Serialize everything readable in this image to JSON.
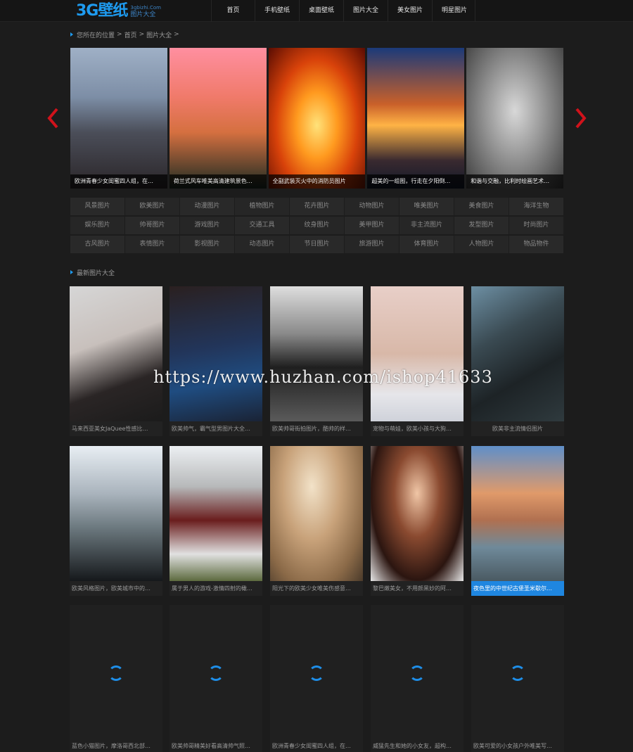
{
  "header": {
    "logo_mark": "3G壁纸",
    "logo_url": "3gbizhi.Com",
    "logo_tag": "图片大全",
    "nav": [
      "首页",
      "手机壁纸",
      "桌面壁纸",
      "图片大全",
      "美女图片",
      "明星图片"
    ]
  },
  "breadcrumb": {
    "label": "您所在的位置",
    "items": [
      "首页",
      "图片大全"
    ],
    "sep": ">"
  },
  "slider": {
    "slides": [
      {
        "caption": "欧洲青春少女闺蜜四人组，在…",
        "art": "g1"
      },
      {
        "caption": "荷兰式风车唯美高清建筑景色…",
        "art": "g2"
      },
      {
        "caption": "全副武装灭火中的消防员图片",
        "art": "g3"
      },
      {
        "caption": "超美的一组图，行走在夕阳倒…",
        "art": "g4"
      },
      {
        "caption": "和谐与交融，比利时绘画艺术…",
        "art": "g5"
      }
    ],
    "prev_icon": "chevron-left-icon",
    "next_icon": "chevron-right-icon",
    "arrow_color": "#d0121b"
  },
  "categories": [
    "风景图片",
    "欧美图片",
    "动漫图片",
    "植物图片",
    "花卉图片",
    "动物图片",
    "唯美图片",
    "美食图片",
    "海洋生物",
    "娱乐图片",
    "帅哥图片",
    "游戏图片",
    "交通工具",
    "纹身图片",
    "美甲图片",
    "非主流图片",
    "发型图片",
    "时尚图片",
    "古风图片",
    "表情图片",
    "影视图片",
    "动态图片",
    "节日图片",
    "旅游图片",
    "体育图片",
    "人物图片",
    "物品物件"
  ],
  "latest": {
    "title": "最新图片大全",
    "rows": [
      [
        {
          "caption": "马来西亚美女JaQuee性感比…",
          "art": "p1"
        },
        {
          "caption": "欧美帅气，霸气型男图片大全…",
          "art": "p2"
        },
        {
          "caption": "欧美帅哥街拍图片，酷帅的样…",
          "art": "p3"
        },
        {
          "caption": "宠物与萌娃，欧美小孩与大狗…",
          "art": "p4"
        },
        {
          "caption": "欧美非主流情侣图片",
          "art": "p5",
          "center": true
        }
      ],
      [
        {
          "caption": "欧美风格图片，欧美城市中的…",
          "art": "p6"
        },
        {
          "caption": "属于男人的游戏-激情四射的橄…",
          "art": "p7"
        },
        {
          "caption": "阳光下的欧美少女唯美伤感意…",
          "art": "p8"
        },
        {
          "caption": "黎巴嫩美女，不用颜黑妙的阿…",
          "art": "p9"
        },
        {
          "caption": "夜色里的中世纪古堡圣米歇尔…",
          "art": "p10",
          "active": true
        }
      ],
      [
        {
          "caption": "蓝色小猫图片，摩洛哥西北部…"
        },
        {
          "caption": "欧美帅哥精美好看高清帅气照…"
        },
        {
          "caption": "欧洲青春少女闺蜜四人组，在…"
        },
        {
          "caption": "威猛先生和她的小女友，超构…"
        },
        {
          "caption": "欧美可爱的小女孩户外唯美写…"
        }
      ]
    ],
    "accent": "#1f86e0",
    "loading_icon": "loading-spinner-icon"
  },
  "watermark": "https://www.huzhan.com/ishop41633"
}
